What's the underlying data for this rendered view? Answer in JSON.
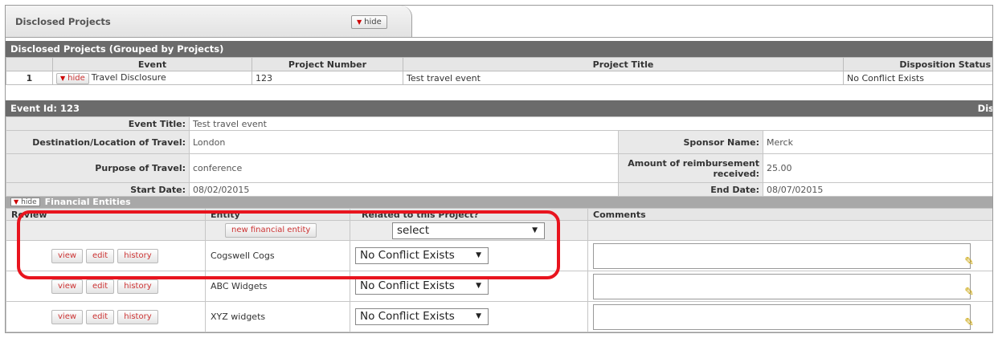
{
  "panel": {
    "title": "Disclosed Projects",
    "hide_label": "hide"
  },
  "projects": {
    "title": "Disclosed Projects (Grouped by Projects)",
    "columns": [
      "Event",
      "Project Number",
      "Project Title",
      "Disposition Status"
    ],
    "row": {
      "index": "1",
      "hide_label": "hide",
      "event": "Travel Disclosure",
      "number": "123",
      "title": "Test travel event",
      "status": "No Conflict Exists"
    }
  },
  "event": {
    "header": "Event Id: 123",
    "header_right": "Dis",
    "title_label": "Event Title:",
    "title_value": "Test travel event",
    "dest_label": "Destination/Location of Travel:",
    "dest_value": "London",
    "sponsor_label": "Sponsor Name:",
    "sponsor_value": "Merck",
    "purpose_label": "Purpose of Travel:",
    "purpose_value": "conference",
    "amount_label": "Amount of reimbursement received:",
    "amount_value": "25.00",
    "start_label": "Start Date:",
    "start_value": "08/02/02015",
    "end_label": "End Date:",
    "end_value": "08/07/02015"
  },
  "financial": {
    "title": "Financial Entities",
    "hide_label": "hide",
    "columns": {
      "review": "Review",
      "entity": "Entity",
      "related": "Related to this Project?",
      "comments": "Comments"
    },
    "new_entity_label": "new financial entity",
    "select_default": "select",
    "buttons": {
      "view": "view",
      "edit": "edit",
      "history": "history"
    },
    "rows": [
      {
        "entity": "Cogswell Cogs",
        "status": "No Conflict Exists"
      },
      {
        "entity": "ABC Widgets",
        "status": "No Conflict Exists"
      },
      {
        "entity": "XYZ widgets",
        "status": "No Conflict Exists"
      }
    ]
  },
  "colors": {
    "header_bar": "#6b6b6b",
    "highlight": "#e8141e",
    "button_text": "#c33333"
  }
}
